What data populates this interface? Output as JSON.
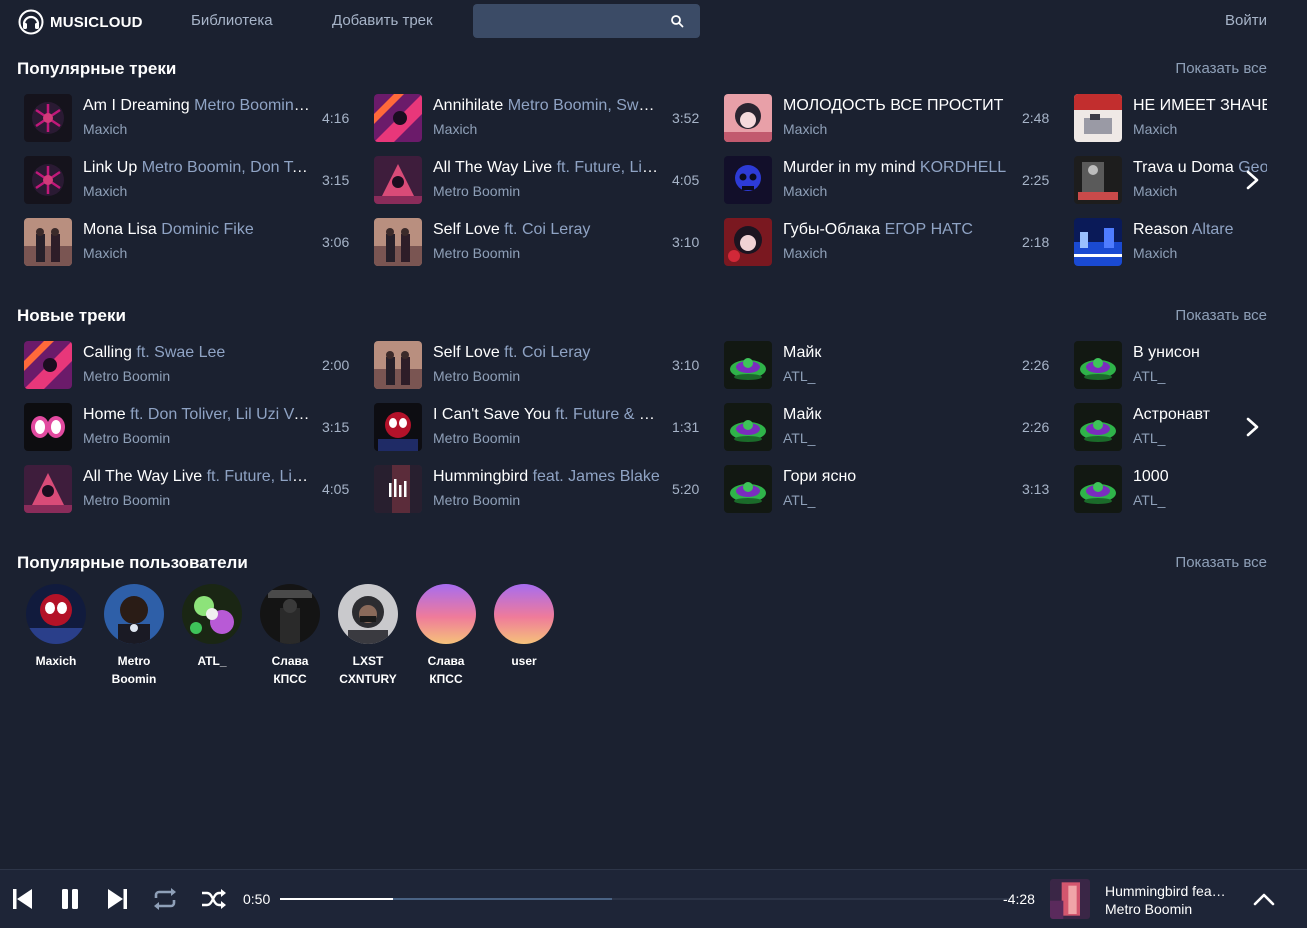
{
  "header": {
    "logo_text": "MUSICLOUD",
    "nav_library": "Библиотека",
    "nav_add_track": "Добавить трек",
    "search_value": "",
    "login": "Войти"
  },
  "popular": {
    "title": "Популярные треки",
    "show_all": "Показать все",
    "tracks": [
      {
        "title": "Am I Dreaming",
        "feat": " Metro Boomin, A$AP Rocky, Roisee",
        "artist": "Maxich",
        "duration": "4:16",
        "cover": "spider-dark"
      },
      {
        "title": "Link Up",
        "feat": " Metro Boomin, Don Toliver, WizKid",
        "artist": "Maxich",
        "duration": "3:15",
        "cover": "spider-dark"
      },
      {
        "title": "Mona Lisa",
        "feat": " Dominic Fike",
        "artist": "Maxich",
        "duration": "3:06",
        "cover": "couple"
      },
      {
        "title": "Annihilate",
        "feat": " Metro Boomin, Swae Lee, Lil Wayne",
        "artist": "Maxich",
        "duration": "3:52",
        "cover": "spider-magenta"
      },
      {
        "title": "All The Way Live",
        "feat": " ft. Future, Lil Uzi Vert",
        "artist": "Metro Boomin",
        "duration": "4:05",
        "cover": "spider-pink"
      },
      {
        "title": "Self Love",
        "feat": " ft. Coi Leray",
        "artist": "Metro Boomin",
        "duration": "3:10",
        "cover": "couple"
      },
      {
        "title": "МОЛОДОСТЬ ВСЕ ПРОСТИТ",
        "feat": " ",
        "artist": "Maxich",
        "duration": "2:48",
        "cover": "anime"
      },
      {
        "title": "Murder in my mind",
        "feat": " KORDHELL",
        "artist": "Maxich",
        "duration": "2:25",
        "cover": "skull"
      },
      {
        "title": "Губы-Облака",
        "feat": " ЕГОР НАТС",
        "artist": "Maxich",
        "duration": "2:18",
        "cover": "anime-red"
      },
      {
        "title": "НЕ ИМЕЕТ ЗНАЧЕНИЯ",
        "feat": "",
        "artist": "Maxich",
        "duration": "",
        "cover": "room"
      },
      {
        "title": "Trava u Doma",
        "feat": " Geo",
        "artist": "Maxich",
        "duration": "",
        "cover": "piano"
      },
      {
        "title": "Reason",
        "feat": " Altare",
        "artist": "Maxich",
        "duration": "",
        "cover": "city"
      }
    ]
  },
  "new": {
    "title": "Новые треки",
    "show_all": "Показать все",
    "tracks": [
      {
        "title": "Calling",
        "feat": " ft. Swae Lee",
        "artist": "Metro Boomin",
        "duration": "2:00",
        "cover": "spider-magenta"
      },
      {
        "title": "Home",
        "feat": " ft. Don Toliver, Lil Uzi Vert",
        "artist": "Metro Boomin",
        "duration": "3:15",
        "cover": "eyes"
      },
      {
        "title": "All The Way Live",
        "feat": " ft. Future, Lil Uzi Vert",
        "artist": "Metro Boomin",
        "duration": "4:05",
        "cover": "spider-pink"
      },
      {
        "title": "Self Love",
        "feat": " ft. Coi Leray",
        "artist": "Metro Boomin",
        "duration": "3:10",
        "cover": "couple"
      },
      {
        "title": "I Can't Save You",
        "feat": " ft. Future & Don Toliver",
        "artist": "Metro Boomin",
        "duration": "1:31",
        "cover": "spider-red"
      },
      {
        "title": "Hummingbird",
        "feat": " feat. James Blake",
        "artist": "Metro Boomin",
        "duration": "5:20",
        "cover": "playing"
      },
      {
        "title": "Майк",
        "feat": "",
        "artist": "ATL_",
        "duration": "2:26",
        "cover": "atl"
      },
      {
        "title": "Майк",
        "feat": "",
        "artist": "ATL_",
        "duration": "2:26",
        "cover": "atl"
      },
      {
        "title": "Гори ясно",
        "feat": "",
        "artist": "ATL_",
        "duration": "3:13",
        "cover": "atl"
      },
      {
        "title": "В унисон",
        "feat": "",
        "artist": "ATL_",
        "duration": "",
        "cover": "atl"
      },
      {
        "title": "Астронавт",
        "feat": "",
        "artist": "ATL_",
        "duration": "",
        "cover": "atl"
      },
      {
        "title": "1000",
        "feat": "",
        "artist": "ATL_",
        "duration": "",
        "cover": "atl"
      }
    ]
  },
  "users": {
    "title": "Популярные пользователи",
    "show_all": "Показать все",
    "list": [
      {
        "name": "Maxich",
        "avatar": "spider-red"
      },
      {
        "name": "Metro Boomin",
        "avatar": "metro"
      },
      {
        "name": "ATL_",
        "avatar": "atl-green"
      },
      {
        "name": "Слава КПСС",
        "avatar": "kpss"
      },
      {
        "name": "LXST CXNTURY",
        "avatar": "hood"
      },
      {
        "name": "Слава КПСС",
        "avatar": "gradient"
      },
      {
        "name": "user",
        "avatar": "gradient"
      }
    ]
  },
  "player": {
    "elapsed": "0:50",
    "remaining": "-4:28",
    "progress": 0.155,
    "buffered": 0.455,
    "now_title": "Hummingbird feat. James Blake",
    "now_artist": "Metro Boomin"
  }
}
